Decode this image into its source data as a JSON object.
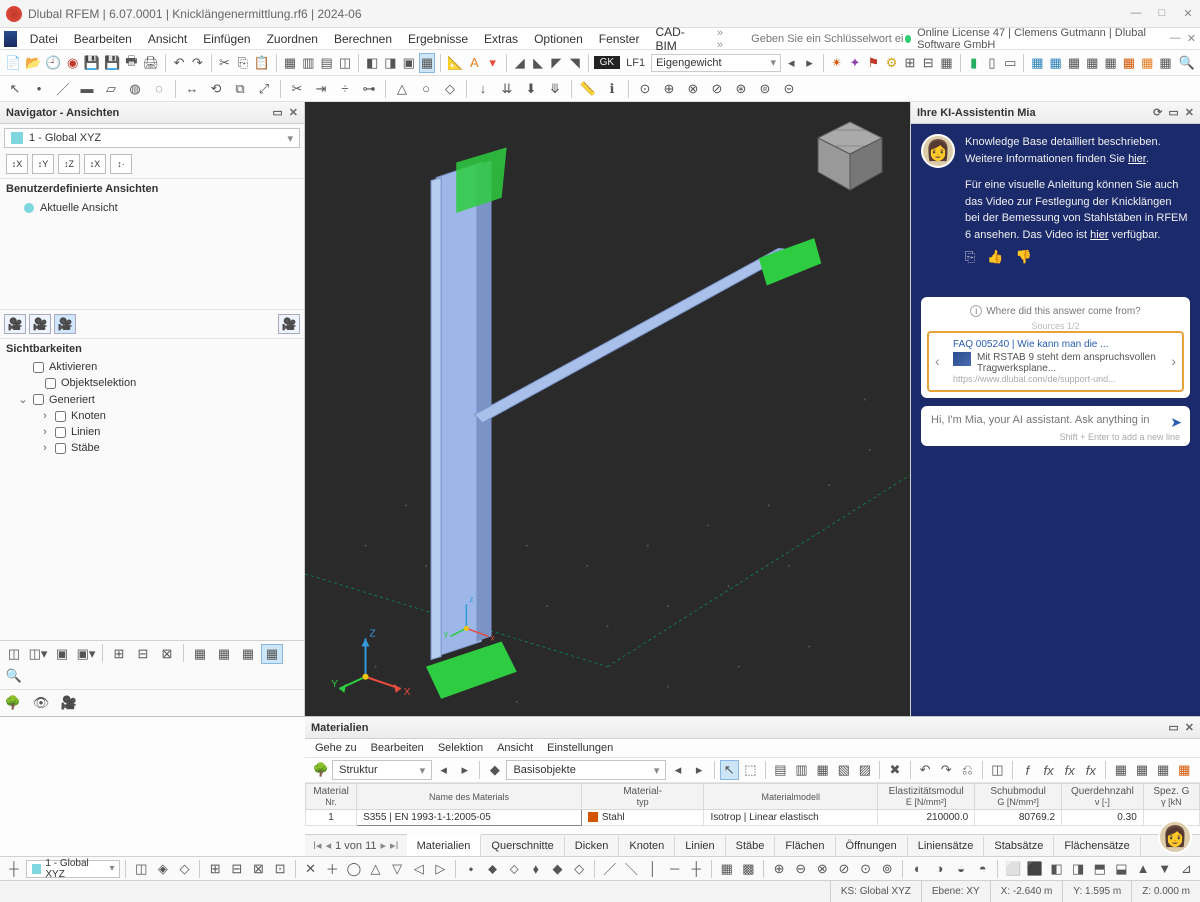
{
  "title": "Dlubal RFEM | 6.07.0001 | Knicklängenermittlung.rf6 | 2024-06",
  "window_buttons": {
    "min": "—",
    "max": "□",
    "close": "✕"
  },
  "menubar": {
    "items": [
      "Datei",
      "Bearbeiten",
      "Ansicht",
      "Einfügen",
      "Zuordnen",
      "Berechnen",
      "Ergebnisse",
      "Extras",
      "Optionen",
      "Fenster",
      "CAD-BIM"
    ],
    "search_placeholder": "Geben Sie ein Schlüsselwort ein (Alt...)",
    "search_prefix": "» »",
    "license": "Online License 47 | Clemens Gutmann | Dlubal Software GmbH"
  },
  "toolbar2": {
    "lf_tag": "LF1",
    "lf_name": "Eigengewicht",
    "gk": "GK"
  },
  "navigator": {
    "title": "Navigator - Ansichten",
    "view_combo": "1 - Global XYZ",
    "axis_labels": [
      "↕X",
      "↕Y",
      "↕Z",
      "↕X",
      "↕·"
    ],
    "userviews_hdr": "Benutzerdefinierte Ansichten",
    "current_view": "Aktuelle Ansicht",
    "visibility_hdr": "Sichtbarkeiten",
    "activate": "Aktivieren",
    "objsel": "Objektselektion",
    "generated": "Generiert",
    "gen_children": [
      "Knoten",
      "Linien",
      "Stäbe"
    ]
  },
  "mia": {
    "title": "Ihre KI-Assistentin Mia",
    "msg1": "Knowledge Base detailliert beschrieben. Weitere Informationen finden Sie ",
    "msg1_link": "hier",
    "msg2a": "Für eine visuelle Anleitung können Sie auch das Video zur Festlegung der Knicklängen bei der Bemessung von Stahlstäben in RFEM 6 ansehen. Das Video ist ",
    "msg2_link": "hier",
    "msg2b": " verfügbar.",
    "source_q": "Where did this answer come from?",
    "sources_lbl": "Sources 1/2",
    "faq_title": "FAQ 005240 | Wie kann man die ...",
    "faq_snip": "Mit RSTAB 9 steht dem anspruchsvollen Tragwerksplane...",
    "faq_url": "https://www.dlubal.com/de/support-und...",
    "input_placeholder": "Hi, I'm Mia, your AI assistant. Ask anything in",
    "hint": "Shift + Enter to add a new line"
  },
  "materials": {
    "title": "Materialien",
    "menus": [
      "Gehe zu",
      "Bearbeiten",
      "Selektion",
      "Ansicht",
      "Einstellungen"
    ],
    "combo_struktur": "Struktur",
    "combo_basis": "Basisobjekte",
    "cols": [
      {
        "h1": "Material",
        "h2": "Nr."
      },
      {
        "h1": "",
        "h2": "Name des Materials"
      },
      {
        "h1": "Material-",
        "h2": "typ"
      },
      {
        "h1": "",
        "h2": "Materialmodell"
      },
      {
        "h1": "Elastizitätsmodul",
        "h2": "E [N/mm²]"
      },
      {
        "h1": "Schubmodul",
        "h2": "G [N/mm²]"
      },
      {
        "h1": "Querdehnzahl",
        "h2": "ν [-]"
      },
      {
        "h1": "Spez. G",
        "h2": "γ [kN"
      }
    ],
    "row": {
      "nr": "1",
      "name": "S355 | EN 1993-1-1:2005-05",
      "type": "Stahl",
      "model": "Isotrop | Linear elastisch",
      "E": "210000.0",
      "G": "80769.2",
      "nu": "0.30"
    },
    "page": "1 von 11",
    "tabs": [
      "Materialien",
      "Querschnitte",
      "Dicken",
      "Knoten",
      "Linien",
      "Stäbe",
      "Flächen",
      "Öffnungen",
      "Liniensätze",
      "Stabsätze",
      "Flächensätze"
    ]
  },
  "bottom_combo": "1 - Global XYZ",
  "status": {
    "ks": "KS: Global XYZ",
    "plane": "Ebene: XY",
    "x": "X: -2.640 m",
    "y": "Y: 1.595 m",
    "z": "Z: 0.000 m"
  },
  "icons": {
    "copy": "⎘",
    "like": "👍",
    "dislike": "👎",
    "send": "➤",
    "refresh": "⟳",
    "pin": "📌",
    "close": "✕",
    "maximize": "▭",
    "info": "i",
    "chev_l": "‹",
    "chev_r": "›"
  }
}
